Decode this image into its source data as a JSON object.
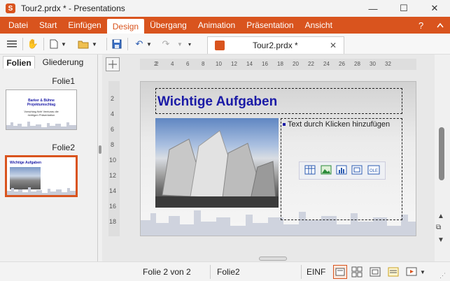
{
  "window": {
    "title": "Tour2.prdx * - Presentations",
    "app_icon": "S"
  },
  "ribbon": {
    "tabs": [
      "Datei",
      "Start",
      "Einfügen",
      "Design",
      "Übergang",
      "Animation",
      "Präsentation",
      "Ansicht"
    ],
    "active_tab": "Design",
    "help": "?"
  },
  "document_tab": {
    "label": "Tour2.prdx *"
  },
  "panel": {
    "tabs": [
      "Folien",
      "Gliederung"
    ],
    "slides": [
      {
        "label": "Folie1",
        "title": "Barker & Bühne\nProjektumschlag",
        "subtitle": "Vorschlag ficht Venturas die\nrichtigen Präsentation"
      },
      {
        "label": "Folie2",
        "title": "Wichtige Aufgaben"
      }
    ]
  },
  "ruler": {
    "horizontal": [
      "2",
      "4",
      "6",
      "8",
      "10",
      "12",
      "14",
      "16",
      "18",
      "20",
      "22",
      "24",
      "26",
      "28",
      "30",
      "32"
    ],
    "vertical": [
      "2",
      "4",
      "6",
      "8",
      "10",
      "12",
      "14",
      "16",
      "18"
    ]
  },
  "slide": {
    "title": "Wichtige Aufgaben",
    "placeholder": "Text durch Klicken hinzufügen",
    "title_color": "#1a1aa6"
  },
  "status": {
    "slide_position": "Folie 2 von 2",
    "slide_name": "Folie2",
    "mode": "EINF"
  },
  "colors": {
    "accent": "#d9541e"
  }
}
